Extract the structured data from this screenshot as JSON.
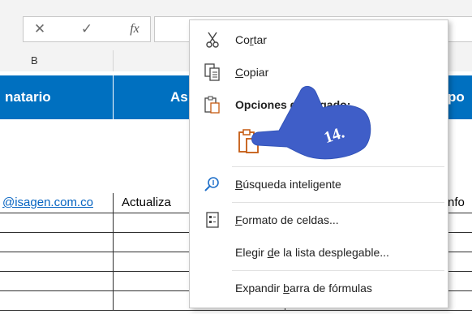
{
  "formula_bar": {
    "cancel_icon": "close-icon",
    "enter_icon": "check-icon",
    "fx_label": "fx",
    "cancel_glyph": "✕",
    "enter_glyph": "✓"
  },
  "column_headers": {
    "b": "B"
  },
  "table": {
    "headers": [
      "natario",
      "As",
      "po"
    ],
    "row1": {
      "email": "@isagen.com.co",
      "subject": "Actualiza",
      "extra": "nfo"
    }
  },
  "context_menu": {
    "cut": {
      "pre": "Co",
      "ul": "r",
      "post": "tar"
    },
    "copy": {
      "pre": "",
      "ul": "C",
      "post": "opiar"
    },
    "paste_options": "Opciones de pegado:",
    "smart_lookup": {
      "pre": "",
      "ul": "B",
      "post": "úsqueda inteligente"
    },
    "format_cells": {
      "pre": "",
      "ul": "F",
      "post": "ormato de celdas..."
    },
    "pick_from_list": {
      "pre": "Elegir ",
      "ul": "d",
      "post": "e la lista desplegable..."
    },
    "expand_formula_bar": {
      "pre": "Expandir ",
      "ul": "b",
      "post": "arra de fórmulas"
    }
  },
  "annotation": {
    "label": "14."
  },
  "colors": {
    "header_blue": "#0070c0",
    "link_blue": "#0563c1",
    "annotation_blue": "#3f5ec8"
  }
}
